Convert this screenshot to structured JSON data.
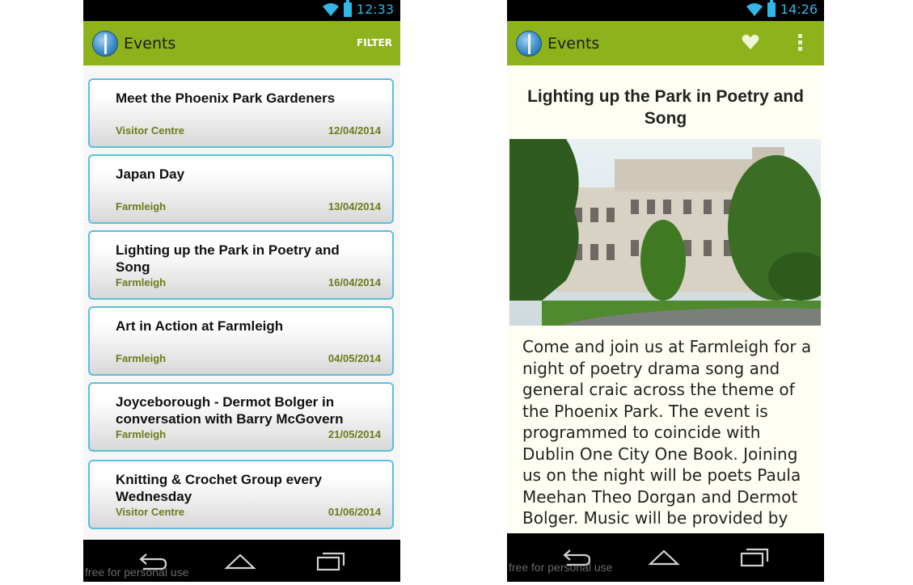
{
  "left_screen": {
    "status": {
      "time": "12:33"
    },
    "action_bar": {
      "title": "Events",
      "filter_label": "FILTER"
    },
    "events": [
      {
        "title": "Meet the Phoenix Park Gardeners",
        "venue": "Visitor Centre",
        "date": "12/04/2014"
      },
      {
        "title": "Japan Day",
        "venue": "Farmleigh",
        "date": "13/04/2014"
      },
      {
        "title": "Lighting up the Park in Poetry and Song",
        "venue": "Farmleigh",
        "date": "16/04/2014"
      },
      {
        "title": "Art in Action at Farmleigh",
        "venue": "Farmleigh",
        "date": "04/05/2014"
      },
      {
        "title": "Joyceborough -  Dermot Bolger in conversation with Barry McGovern",
        "venue": "Farmleigh",
        "date": "21/05/2014"
      },
      {
        "title": "Knitting & Crochet Group every Wednesday",
        "venue": "Visitor Centre",
        "date": "01/06/2014"
      }
    ],
    "nav_icons": [
      "back-icon",
      "home-icon",
      "recent-apps-icon"
    ],
    "watermark": "free for personal use"
  },
  "right_screen": {
    "status": {
      "time": "14:26"
    },
    "action_bar": {
      "title": "Events",
      "favorite_icon": "heart-icon",
      "menu_icon": "overflow-menu-icon"
    },
    "detail": {
      "title": "Lighting up the Park in Poetry and Song",
      "body": "Come and join us at Farmleigh for a night of poetry drama song and general craic across the theme of the Phoenix Park. The event is programmed to coincide with Dublin One City One Book. Joining us on the night will be poets Paula Meehan Theo Dorgan and Dermot Bolger. Music will be provided by"
    },
    "nav_icons": [
      "back-icon",
      "home-icon",
      "recent-apps-icon"
    ],
    "watermark": "free for personal use"
  },
  "colors": {
    "action_bar": "#8eb21c",
    "status_icons": "#33b5e5",
    "card_border": "#5bbfe0",
    "venue_date_text": "#6b7b1c"
  }
}
